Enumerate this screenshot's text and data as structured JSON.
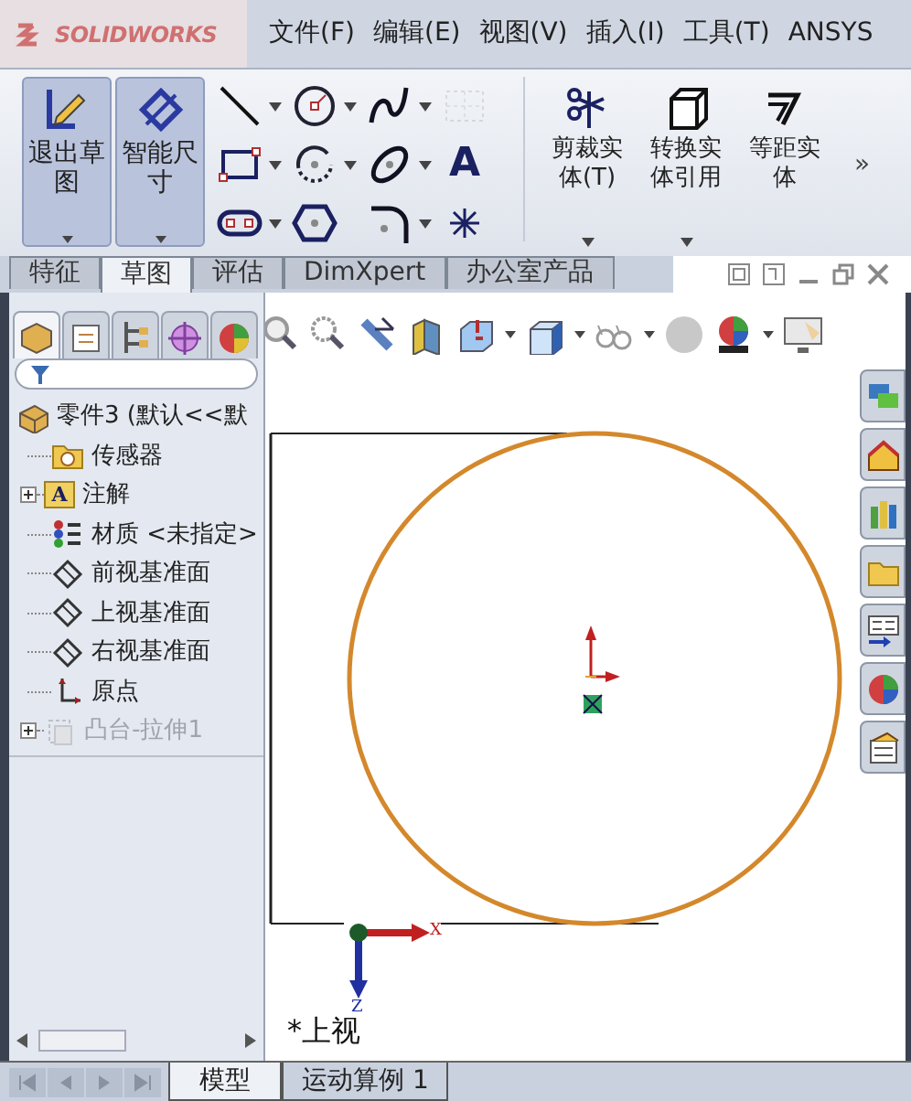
{
  "app": {
    "logo": "SOLIDWORKS"
  },
  "menu": [
    {
      "label": "文件(F)"
    },
    {
      "label": "编辑(E)"
    },
    {
      "label": "视图(V)"
    },
    {
      "label": "插入(I)"
    },
    {
      "label": "工具(T)"
    },
    {
      "label": "ANSYS"
    }
  ],
  "ribbon": {
    "big_buttons": [
      {
        "label": "退出草图",
        "kind": "exit-sketch",
        "selected": true
      },
      {
        "label": "智能尺寸",
        "kind": "smart-dimension",
        "selected": true
      }
    ],
    "tools": [
      {
        "kind": "line",
        "dropdown": true,
        "disabled": false
      },
      {
        "kind": "circle",
        "dropdown": true,
        "disabled": false
      },
      {
        "kind": "spline",
        "dropdown": true,
        "disabled": false
      },
      {
        "kind": "grid",
        "dropdown": false,
        "disabled": true
      },
      {
        "kind": "rectangle",
        "dropdown": true,
        "disabled": false
      },
      {
        "kind": "arc",
        "dropdown": true,
        "disabled": false
      },
      {
        "kind": "ellipse",
        "dropdown": true,
        "disabled": false
      },
      {
        "kind": "text",
        "glyph": "A",
        "dropdown": false,
        "disabled": false
      },
      {
        "kind": "slot",
        "dropdown": true,
        "disabled": false
      },
      {
        "kind": "polygon",
        "dropdown": false,
        "disabled": false
      },
      {
        "kind": "fillet",
        "dropdown": true,
        "disabled": false
      },
      {
        "kind": "point",
        "dropdown": false,
        "disabled": false
      }
    ],
    "commands": [
      {
        "label": "剪裁实体(T)",
        "kind": "trim",
        "dropdown": true
      },
      {
        "label": "转换实体引用",
        "kind": "convert",
        "dropdown": true
      },
      {
        "label": "等距实体",
        "kind": "offset",
        "dropdown": false
      }
    ],
    "more": "»"
  },
  "tabs": [
    {
      "label": "特征",
      "selected": false
    },
    {
      "label": "草图",
      "selected": true
    },
    {
      "label": "评估",
      "selected": false
    },
    {
      "label": "DimXpert",
      "selected": false
    },
    {
      "label": "办公室产品",
      "selected": false
    }
  ],
  "panel_tabs": [
    {
      "kind": "feature-tree",
      "selected": true
    },
    {
      "kind": "property",
      "selected": false
    },
    {
      "kind": "configuration",
      "selected": false
    },
    {
      "kind": "dimxpert",
      "selected": false
    },
    {
      "kind": "appearance",
      "selected": false
    }
  ],
  "tree": {
    "root": {
      "label": "零件3 (默认<<默"
    },
    "items": [
      {
        "label": "传感器",
        "kind": "sensor",
        "expandable": false,
        "disabled": false
      },
      {
        "label": "注解",
        "kind": "annotation",
        "glyph": "A",
        "expandable": true,
        "disabled": false
      },
      {
        "label": "材质 <未指定>",
        "kind": "material",
        "expandable": false,
        "disabled": false
      },
      {
        "label": "前视基准面",
        "kind": "plane",
        "expandable": false,
        "disabled": false
      },
      {
        "label": "上视基准面",
        "kind": "plane",
        "expandable": false,
        "disabled": false
      },
      {
        "label": "右视基准面",
        "kind": "plane",
        "expandable": false,
        "disabled": false
      },
      {
        "label": "原点",
        "kind": "origin",
        "expandable": false,
        "disabled": false
      },
      {
        "label": "凸台-拉伸1",
        "kind": "extrude",
        "expandable": true,
        "disabled": true
      }
    ]
  },
  "viewport": {
    "view_label": "*上视",
    "axis_x": "X",
    "axis_z": "Z"
  },
  "bottom_tabs": [
    {
      "label": "模型",
      "selected": true
    },
    {
      "label": "运动算例 1",
      "selected": false
    }
  ]
}
